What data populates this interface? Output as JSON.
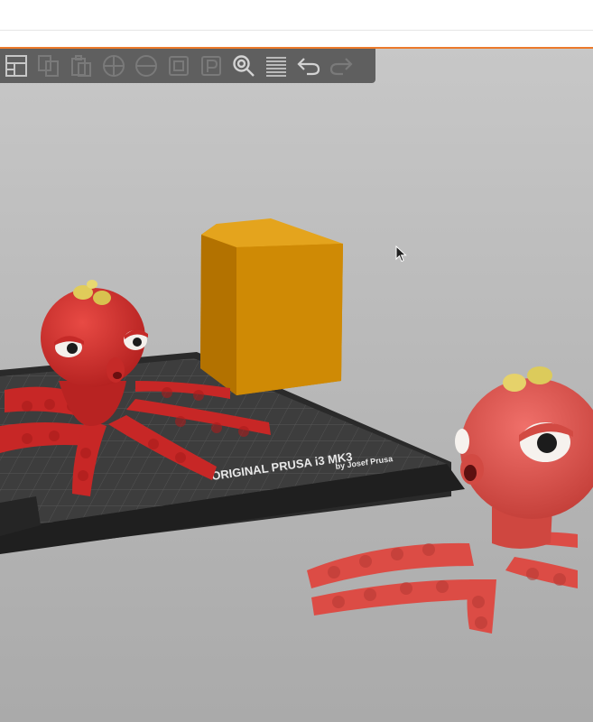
{
  "app": {
    "accent_color": "#ec7a2b",
    "viewport_bg": "#b9b9b9"
  },
  "toolbar": {
    "items": [
      {
        "name": "layout-icon",
        "enabled": true
      },
      {
        "name": "copy-icon",
        "enabled": false
      },
      {
        "name": "paste-icon",
        "enabled": false
      },
      {
        "name": "add-instance-icon",
        "enabled": false
      },
      {
        "name": "remove-instance-icon",
        "enabled": false
      },
      {
        "name": "split-objects-icon",
        "enabled": false
      },
      {
        "name": "split-parts-icon",
        "enabled": false
      },
      {
        "name": "search-icon",
        "enabled": true
      },
      {
        "name": "layers-icon",
        "enabled": true
      },
      {
        "name": "undo-icon",
        "enabled": true
      },
      {
        "name": "redo-icon",
        "enabled": false
      }
    ]
  },
  "bed": {
    "label_line1": "ORIGINAL PRUSA i3 MK3",
    "label_line2": "by Josef Prusa"
  },
  "objects": [
    {
      "name": "octopus-model-left",
      "color": "#d82e2e"
    },
    {
      "name": "wipe-tower",
      "color": "#d6940a"
    },
    {
      "name": "octopus-model-right",
      "color": "#e0544c"
    }
  ]
}
